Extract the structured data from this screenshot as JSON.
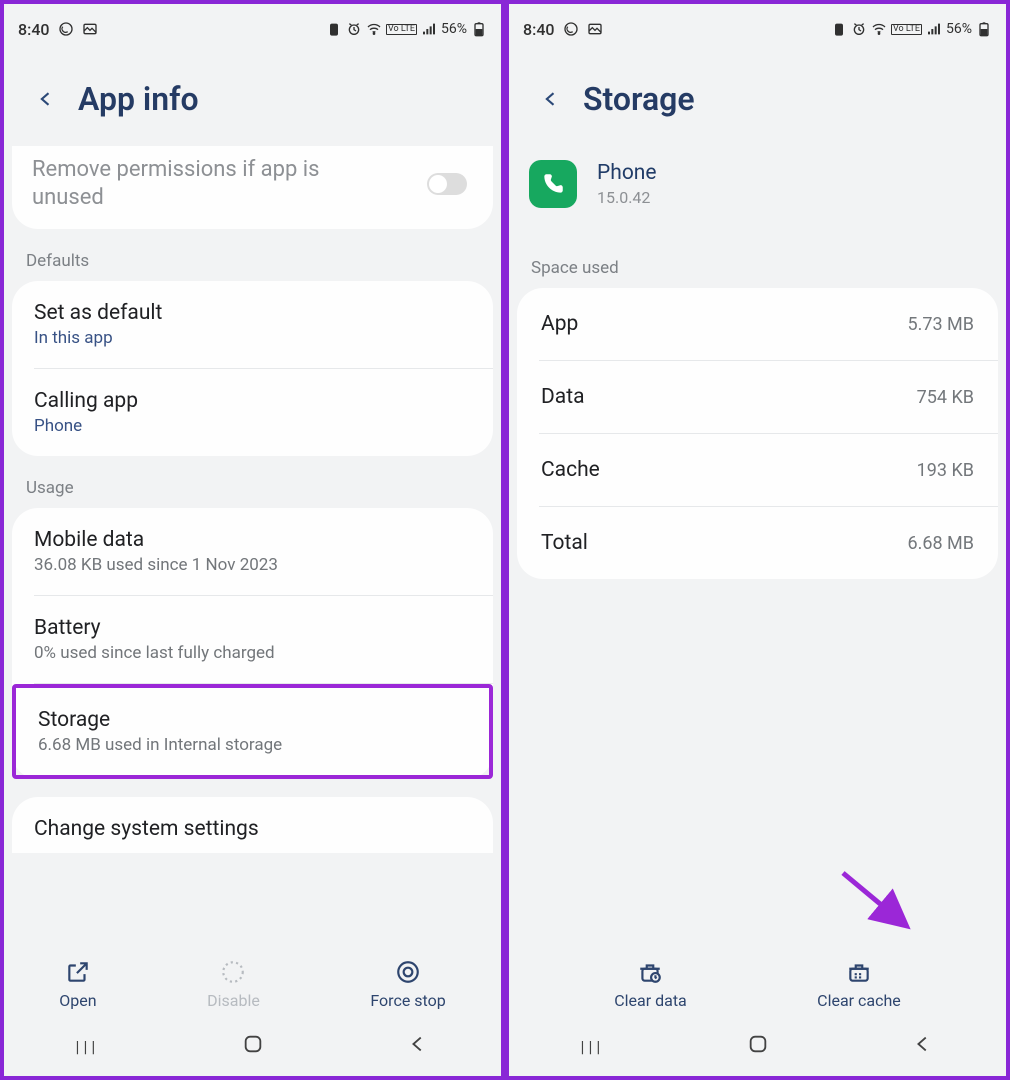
{
  "status": {
    "time": "8:40",
    "battery": "56%",
    "volte": "Vo LTE"
  },
  "left": {
    "title": "App info",
    "remove_perms": "Remove permissions if app is unused",
    "section_defaults": "Defaults",
    "set_default": {
      "title": "Set as default",
      "sub": "In this app"
    },
    "calling_app": {
      "title": "Calling app",
      "sub": "Phone"
    },
    "section_usage": "Usage",
    "mobile_data": {
      "title": "Mobile data",
      "sub": "36.08 KB used since 1 Nov 2023"
    },
    "battery": {
      "title": "Battery",
      "sub": "0% used since last fully charged"
    },
    "storage": {
      "title": "Storage",
      "sub": "6.68 MB used in Internal storage"
    },
    "change_sys": "Change system settings",
    "actions": {
      "open": "Open",
      "disable": "Disable",
      "force_stop": "Force stop"
    }
  },
  "right": {
    "title": "Storage",
    "app": {
      "name": "Phone",
      "version": "15.0.42"
    },
    "section": "Space used",
    "rows": {
      "app": {
        "label": "App",
        "value": "5.73 MB"
      },
      "data": {
        "label": "Data",
        "value": "754 KB"
      },
      "cache": {
        "label": "Cache",
        "value": "193 KB"
      },
      "total": {
        "label": "Total",
        "value": "6.68 MB"
      }
    },
    "actions": {
      "clear_data": "Clear data",
      "clear_cache": "Clear cache"
    }
  }
}
